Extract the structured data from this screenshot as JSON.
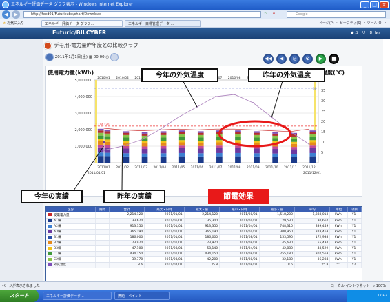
{
  "window": {
    "title": "エネルギー評価データ グラフ表示 - Windows Internet Explorer"
  },
  "browser": {
    "url": "http://feed01/Futuricube/chart/Download",
    "search_placeholder": "Google",
    "favorites_label": "お気に入り",
    "tabs": [
      "エネルギー評価データ グラフ...",
      "エネルギー目標管理データ ..."
    ],
    "tools": "ページ(P) ・ セーフティ(S) ・ ツール(O) ・"
  },
  "app": {
    "brand": "Futuric/BILCYBER",
    "user": "ユーザーID: fws"
  },
  "page": {
    "title": "デモ用-電力量昨年度との比較グラフ",
    "date": "2011年1月1日(土)",
    "time": "00:00"
  },
  "chart_data": {
    "type": "bar",
    "ylabel_left": "使用電力量(kWh)",
    "ylabel_right": "温度(℃)",
    "categories": [
      "2010/01",
      "2010/02",
      "2010/03",
      "2010/04",
      "2010/05",
      "2010/06",
      "2010/07",
      "2010/08",
      "2010/09",
      "2010/10",
      "2010/11",
      "2010/12"
    ],
    "categories_bottom": [
      "2011/01",
      "2011/02",
      "2011/03",
      "2011/04",
      "2011/05",
      "2011/06",
      "2011/07",
      "2011/08",
      "2011/09",
      "2011/10",
      "2011/11",
      "2011/12"
    ],
    "bottom_left_label": "2011/01/01",
    "bottom_right_label": "2011/12/01",
    "ylim_left": [
      0,
      5000000
    ],
    "yticks_left": [
      "5,000,000",
      "4,000,000",
      "3,000,000",
      "2,000,000",
      "1,000,000"
    ],
    "ylim_right": [
      0,
      40
    ],
    "yticks_right": [
      "40",
      "35",
      "30",
      "25",
      "20",
      "15",
      "10",
      "5"
    ],
    "reference_line_value": 2214120,
    "reference_line_label": "2,214,120",
    "reference_temp_value": 36,
    "reference_temp_label": "36",
    "series": [
      {
        "name": "今年の実績",
        "values": [
          2050000,
          null,
          null,
          null,
          null,
          null,
          null,
          null,
          null,
          null,
          null,
          null
        ]
      },
      {
        "name": "昨年の実績",
        "values": [
          2000000,
          1900000,
          1850000,
          1900000,
          1950000,
          1900000,
          1950000,
          1950000,
          1900000,
          1850000,
          1800000,
          1950000
        ]
      },
      {
        "name": "今年の外気温度",
        "values": [
          10,
          null,
          null,
          null,
          null,
          null,
          null,
          null,
          null,
          null,
          null,
          null
        ]
      },
      {
        "name": "昨年の外気温度",
        "values": [
          6,
          8,
          11,
          16,
          22,
          27,
          32,
          33,
          29,
          22,
          15,
          9
        ]
      }
    ],
    "annotations": [
      "今年の外気温度",
      "昨年の外気温度",
      "今年の実績",
      "昨年の実績",
      "節電効果"
    ],
    "colors": {
      "bar_segments": [
        "#1b3a8a",
        "#3d7fd1",
        "#6c3aa1",
        "#c14a9a",
        "#e58a1b",
        "#f2c21a",
        "#3f9a3a",
        "#8bc34a",
        "#b03030",
        "#7d4fb8"
      ],
      "reference": "#e33",
      "temp_ref": "#6677cc",
      "temp_last_year": "#b088c0",
      "temp_this_year": "#6a3aa8"
    }
  },
  "table": {
    "headers": [
      "区分",
      "期間",
      "合計",
      "最大・日時",
      "最大・値",
      "最小・日時",
      "最小・値",
      "平均",
      "単位",
      "項目"
    ],
    "rows": [
      {
        "color": "#c92828",
        "name": "受電電力量",
        "period": "",
        "total": "2,214,120",
        "maxdate": "2011/01/01",
        "maxval": "2,214,120",
        "mindate": "2011/08/01",
        "minval": "1,518,200",
        "avg": "1,888,013",
        "unit": "kWh",
        "item": "Y1"
      },
      {
        "color": "#1b3a8a",
        "name": "A1棟",
        "period": "",
        "total": "33,670",
        "maxdate": "2011/06/01",
        "maxval": "35,300",
        "mindate": "2011/04/01",
        "minval": "29,530",
        "avg": "30,662",
        "unit": "kWh",
        "item": "Y1"
      },
      {
        "color": "#3d7fd1",
        "name": "A2棟",
        "period": "",
        "total": "913,350",
        "maxdate": "2011/01/01",
        "maxval": "913,350",
        "mindate": "2011/04/01",
        "minval": "748,310",
        "avg": "839,449",
        "unit": "kWh",
        "item": "Y1"
      },
      {
        "color": "#6c3aa1",
        "name": "A3棟",
        "period": "",
        "total": "365,190",
        "maxdate": "2011/01/01",
        "maxval": "365,190",
        "mindate": "2011/04/01",
        "minval": "300,950",
        "avg": "328,463",
        "unit": "kWh",
        "item": "Y1"
      },
      {
        "color": "#2a4fa8",
        "name": "B1棟",
        "period": "",
        "total": "186,000",
        "maxdate": "2011/01/01",
        "maxval": "186,000",
        "mindate": "2011/08/01",
        "minval": "153,590",
        "avg": "172,938",
        "unit": "kWh",
        "item": "Y1"
      },
      {
        "color": "#e58a1b",
        "name": "B2棟",
        "period": "",
        "total": "73,970",
        "maxdate": "2011/01/01",
        "maxval": "73,970",
        "mindate": "2011/08/01",
        "minval": "45,630",
        "avg": "55,434",
        "unit": "kWh",
        "item": "Y1"
      },
      {
        "color": "#f2c21a",
        "name": "B3棟",
        "period": "",
        "total": "47,100",
        "maxdate": "2011/08/01",
        "maxval": "58,140",
        "mindate": "2011/04/01",
        "minval": "42,880",
        "avg": "48,529",
        "unit": "kWh",
        "item": "Y1"
      },
      {
        "color": "#3f9a3a",
        "name": "C1棟",
        "period": "",
        "total": "434,150",
        "maxdate": "2011/01/01",
        "maxval": "434,150",
        "mindate": "2011/08/01",
        "minval": "255,180",
        "avg": "302,563",
        "unit": "kWh",
        "item": "Y1"
      },
      {
        "color": "#8bc34a",
        "name": "C2棟",
        "period": "",
        "total": "39,770",
        "maxdate": "2011/03/01",
        "maxval": "42,200",
        "mindate": "2011/08/01",
        "minval": "32,180",
        "avg": "36,204",
        "unit": "kWh",
        "item": "Y1"
      },
      {
        "color": "#7d4fb8",
        "name": "外気温度",
        "period": "",
        "total": "8.6",
        "maxdate": "2011/07/01",
        "maxval": "35.8",
        "mindate": "2011/08/01",
        "minval": "8.6",
        "avg": "25.8",
        "unit": "℃",
        "item": "Y2"
      }
    ]
  },
  "status": {
    "left": "ページが表示されました",
    "zone": "ローカル イントラネット",
    "zoom": "100%"
  },
  "taskbar": {
    "start": "スタート",
    "task1": "エネルギー評価データ...",
    "task2": "無題 - ペイント",
    "clock": "17:42"
  }
}
